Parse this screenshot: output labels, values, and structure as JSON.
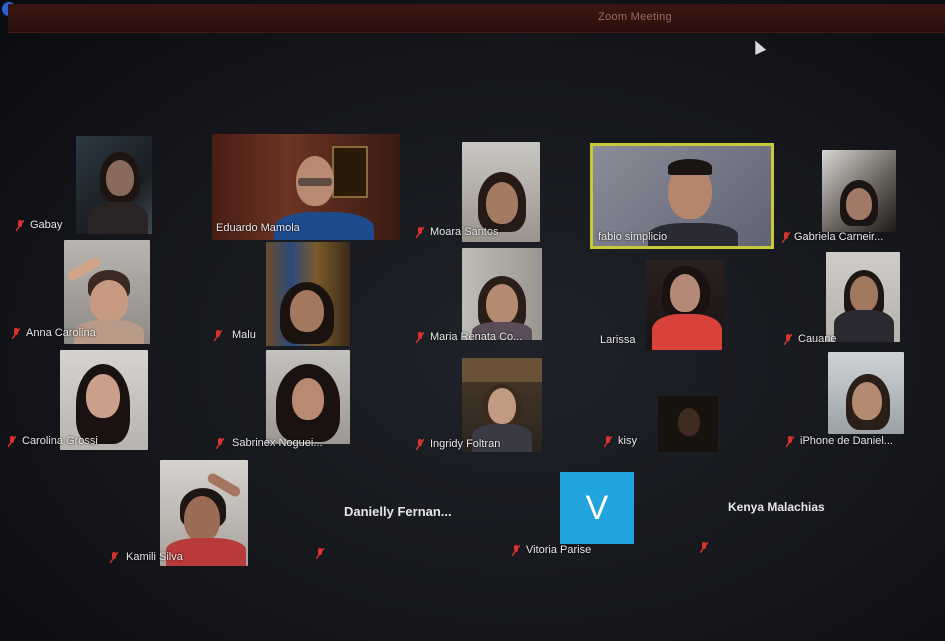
{
  "window": {
    "title": "Zoom Meeting"
  },
  "participants": [
    {
      "name": "Gabay",
      "muted": true
    },
    {
      "name": "Eduardo Mamola",
      "muted": false
    },
    {
      "name": "Moara Santos",
      "muted": true
    },
    {
      "name": "fabio simplicio",
      "muted": false,
      "active_speaker": true
    },
    {
      "name": "Gabriela Carneir...",
      "muted": true
    },
    {
      "name": "Anna Carolina",
      "muted": true
    },
    {
      "name": "Malu",
      "muted": true
    },
    {
      "name": "Maria Renata Co...",
      "muted": true
    },
    {
      "name": "Larissa",
      "muted": false
    },
    {
      "name": "Cauane",
      "muted": true
    },
    {
      "name": "Carolina Grossi",
      "muted": true
    },
    {
      "name": "Sabrinex Noguei...",
      "muted": true
    },
    {
      "name": "Ingridy Foltran",
      "muted": true
    },
    {
      "name": "kisy",
      "muted": true
    },
    {
      "name": "iPhone de Daniel...",
      "muted": true
    },
    {
      "name": "Kamili Silva",
      "muted": true
    },
    {
      "name": "Danielly  Fernan...",
      "muted": true,
      "video_off": true
    },
    {
      "name": "Vitoria Parise",
      "muted": true,
      "avatar_letter": "V"
    },
    {
      "name": "Kenya Malachias",
      "muted": true,
      "video_off": true
    }
  ],
  "colors": {
    "muted_icon": "#d9342b",
    "active_speaker_border": "#c9c83a",
    "avatar_bg": "#21a3de"
  }
}
